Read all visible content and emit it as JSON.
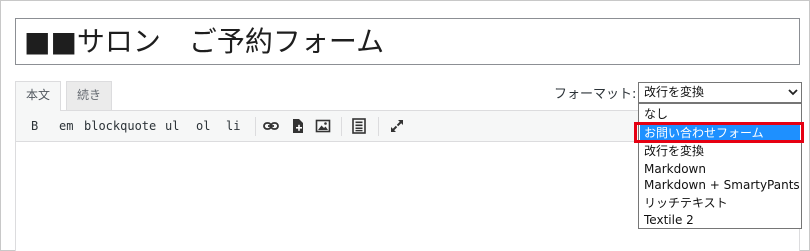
{
  "title_field": {
    "value": "■■サロン　ご予約フォーム"
  },
  "tabs": [
    {
      "label": "本文",
      "active": true
    },
    {
      "label": "続き",
      "active": false
    }
  ],
  "format": {
    "label": "フォーマット:",
    "selected": "改行を変換",
    "options": [
      "なし",
      "お問い合わせフォーム",
      "改行を変換",
      "Markdown",
      "Markdown + SmartyPants",
      "リッチテキスト",
      "Textile 2"
    ],
    "highlighted": "お問い合わせフォーム"
  },
  "toolbar": {
    "buttons": [
      "B",
      "em",
      "blockquote",
      "ul",
      "ol",
      "li"
    ],
    "icons": [
      "link-icon",
      "insert-file-icon",
      "insert-image-icon",
      "template-icon",
      "fullscreen-icon"
    ]
  },
  "colors": {
    "highlight": "#1e90ff",
    "annotation": "#e60012"
  }
}
